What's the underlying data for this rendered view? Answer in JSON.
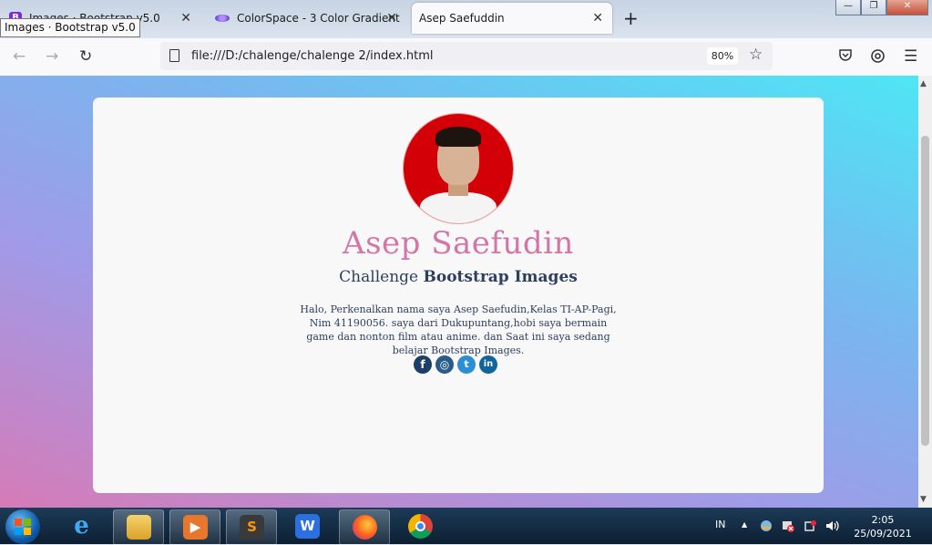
{
  "tabs": [
    {
      "label": "Images · Bootstrap v5.0",
      "favicon": "bootstrap-icon",
      "active": false
    },
    {
      "label": "ColorSpace - 3 Color Gradient",
      "favicon": "colorspace-icon",
      "active": false
    },
    {
      "label": "Asep Saefuddin",
      "favicon": "",
      "active": true
    }
  ],
  "tooltip": "Images · Bootstrap v5.0",
  "new_tab_label": "+",
  "window_controls": {
    "minimize": "—",
    "restore": "❐",
    "close": "✕"
  },
  "navigation": {
    "back": "←",
    "forward": "→",
    "reload": "↻",
    "url": "file:///D:/chalenge/chalenge 2/index.html",
    "zoom": "80%",
    "bookmark": "☆",
    "pocket": "pocket-icon",
    "extensions": "extensions-icon",
    "menu": "☰"
  },
  "profile": {
    "name": "Asep Saefudin",
    "subtitle_prefix": "Challenge ",
    "subtitle_bold": "Bootstrap Images",
    "bio": "Halo, Perkenalkan nama saya Asep Saefudin,Kelas TI-AP-Pagi, Nim 41190056. saya dari Dukupuntang,hobi saya bermain game dan nonton film atau anime. dan Saat ini saya sedang belajar Bootstrap Images.",
    "socials": [
      {
        "name": "facebook",
        "glyph": "f"
      },
      {
        "name": "instagram",
        "glyph": "◎"
      },
      {
        "name": "twitter",
        "glyph": "t"
      },
      {
        "name": "linkedin",
        "glyph": "in"
      }
    ]
  },
  "taskbar": {
    "apps": [
      "internet-explorer",
      "file-explorer",
      "media-player",
      "sublime-text",
      "wps-writer",
      "firefox",
      "chrome"
    ],
    "tray_lang": "IN",
    "tray_arrow": "▲",
    "time": "2:05",
    "date": "25/09/2021"
  },
  "colors": {
    "name": "#d276a8",
    "subtitle": "#2c3f60",
    "avatar_bg": "#d30008",
    "gradient": [
      "#4ee6f5",
      "#79b6ef",
      "#a19ae7",
      "#d57bb7"
    ]
  }
}
